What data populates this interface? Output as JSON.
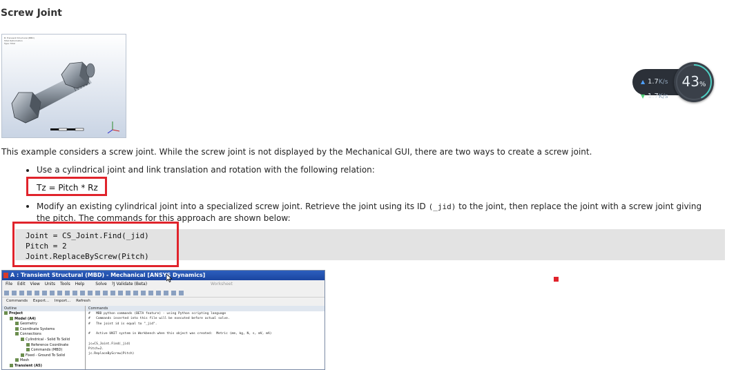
{
  "page": {
    "title": "Screw Joint",
    "intro": "This example considers a screw joint. While the screw joint is not displayed by the Mechanical GUI, there are two ways to create a screw joint.",
    "bullet1": "Use a cylindrical joint and link translation and rotation with the following relation:",
    "formula": "Tz = Pitch * Rz",
    "bullet2_before": "Modify an existing cylindrical joint into a specialized screw joint. Retrieve the joint using its ID",
    "bullet2_code": "(_jid)",
    "bullet2_after": "to the joint, then replace the joint with a screw joint giving the pitch. The commands for this approach are shown below:",
    "code": "Joint = CS_Joint.Find(_jid)\nPitch = 2\nJoint.ReplaceByScrew(Pitch)"
  },
  "figure": {
    "header_line1": "B: Transient Structural (MBD)",
    "header_line2": "Total Deformation",
    "header_line3": "Type: Total"
  },
  "network_widget": {
    "upload": "1.7",
    "download": "1.7",
    "unit": "K/s",
    "percent": "43",
    "percent_sign": "%",
    "percent_value": 43
  },
  "mechanical": {
    "title": "A : Transient Structural (MBD) - Mechanical [ANSYS Dynamics]",
    "menu": [
      "File",
      "Edit",
      "View",
      "Units",
      "Tools",
      "Help"
    ],
    "solve_label": "Solve",
    "validate_label": "?J Validate (Beta)",
    "worksheet_label": "Worksheet",
    "cmd_bar": [
      "Commands",
      "Export...",
      "Import...",
      "Refresh"
    ],
    "outline_header": "Outline",
    "commands_header": "Commands",
    "tree": [
      {
        "label": "Project",
        "indent": 0
      },
      {
        "label": "Model (A4)",
        "indent": 1
      },
      {
        "label": "Geometry",
        "indent": 2
      },
      {
        "label": "Coordinate Systems",
        "indent": 2
      },
      {
        "label": "Connections",
        "indent": 2
      },
      {
        "label": "Cylindrical - Solid To Solid",
        "indent": 3
      },
      {
        "label": "Reference Coordinate",
        "indent": 4
      },
      {
        "label": "Commands (MBD)",
        "indent": 4
      },
      {
        "label": "Fixed - Ground To Solid",
        "indent": 3
      },
      {
        "label": "Mesh",
        "indent": 2
      },
      {
        "label": "Transient (A5)",
        "indent": 1
      }
    ],
    "commands_text": "#   MBD python commands (BETA feature) - using Python scripting language\n#   Commands inserted into this file will be executed before actual solve.\n#   The joint id is equal to \"_jid\".\n\n#   Active UNIT system in Workbench when this object was created:  Metric (mm, kg, N, s, mV, mA)\n\njc=CS_Joint.Find(_jid)\nPitch=2.\njc.ReplaceByScrew(Pitch)"
  },
  "colors": {
    "highlight_red": "#e0232b",
    "code_bg": "#e3e3e3",
    "widget_dark": "#2b3038",
    "gauge_arc": "#4fd1c5"
  }
}
